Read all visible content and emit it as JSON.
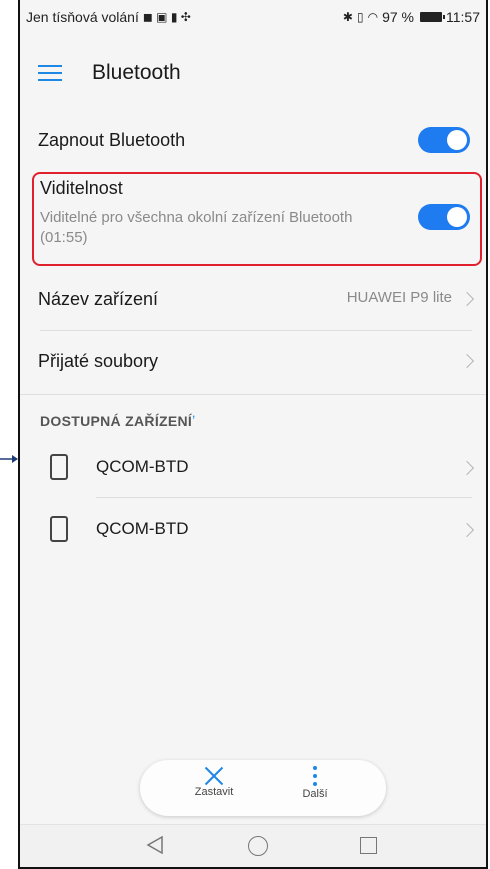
{
  "status_bar": {
    "carrier": "Jen tísňová volání",
    "battery_percent": "97 %",
    "time": "11:57"
  },
  "app_bar": {
    "title": "Bluetooth"
  },
  "settings": {
    "bluetooth_toggle": {
      "label": "Zapnout Bluetooth",
      "on": true
    },
    "visibility": {
      "label": "Viditelnost",
      "description": "Viditelné pro všechna okolní zařízení Bluetooth (01:55)",
      "on": true
    },
    "device_name": {
      "label": "Název zařízení",
      "value": "HUAWEI P9 lite"
    },
    "received_files": {
      "label": "Přijaté soubory"
    }
  },
  "available_devices": {
    "header": "DOSTUPNÁ ZAŘÍZENÍ",
    "items": [
      {
        "name": "QCOM-BTD",
        "icon": "phone-icon"
      },
      {
        "name": "QCOM-BTD",
        "icon": "phone-icon"
      }
    ]
  },
  "bottom_actions": {
    "stop_label": "Zastavit",
    "more_label": "Další"
  },
  "colors": {
    "accent": "#1e88e5",
    "toggle_on": "#1e7bf0",
    "highlight": "#e0202c"
  }
}
